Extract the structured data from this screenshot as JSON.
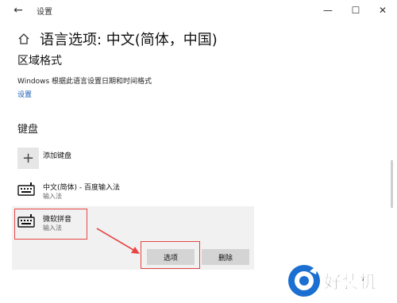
{
  "window": {
    "title": "设置"
  },
  "titlebar": {
    "back": "←",
    "min": "—",
    "max": "☐",
    "close": "✕"
  },
  "header": {
    "title": "语言选项: 中文(简体，中国)"
  },
  "region": {
    "section_title": "区域格式",
    "description": "Windows 根据此语言设置日期和时间格式",
    "link": "设置"
  },
  "keyboard": {
    "section_title": "键盘",
    "add_label": "添加键盘",
    "items": [
      {
        "title": "中文(简体) - 百度输入法",
        "subtitle": "输入法"
      },
      {
        "title": "微软拼音",
        "subtitle": "输入法"
      }
    ],
    "buttons": {
      "options": "选项",
      "delete": "删除"
    }
  },
  "watermark": {
    "text": "好装机"
  },
  "colors": {
    "accent_link": "#1a5fb4",
    "annotation": "#e64545",
    "button_bg": "#d4d4d4"
  }
}
